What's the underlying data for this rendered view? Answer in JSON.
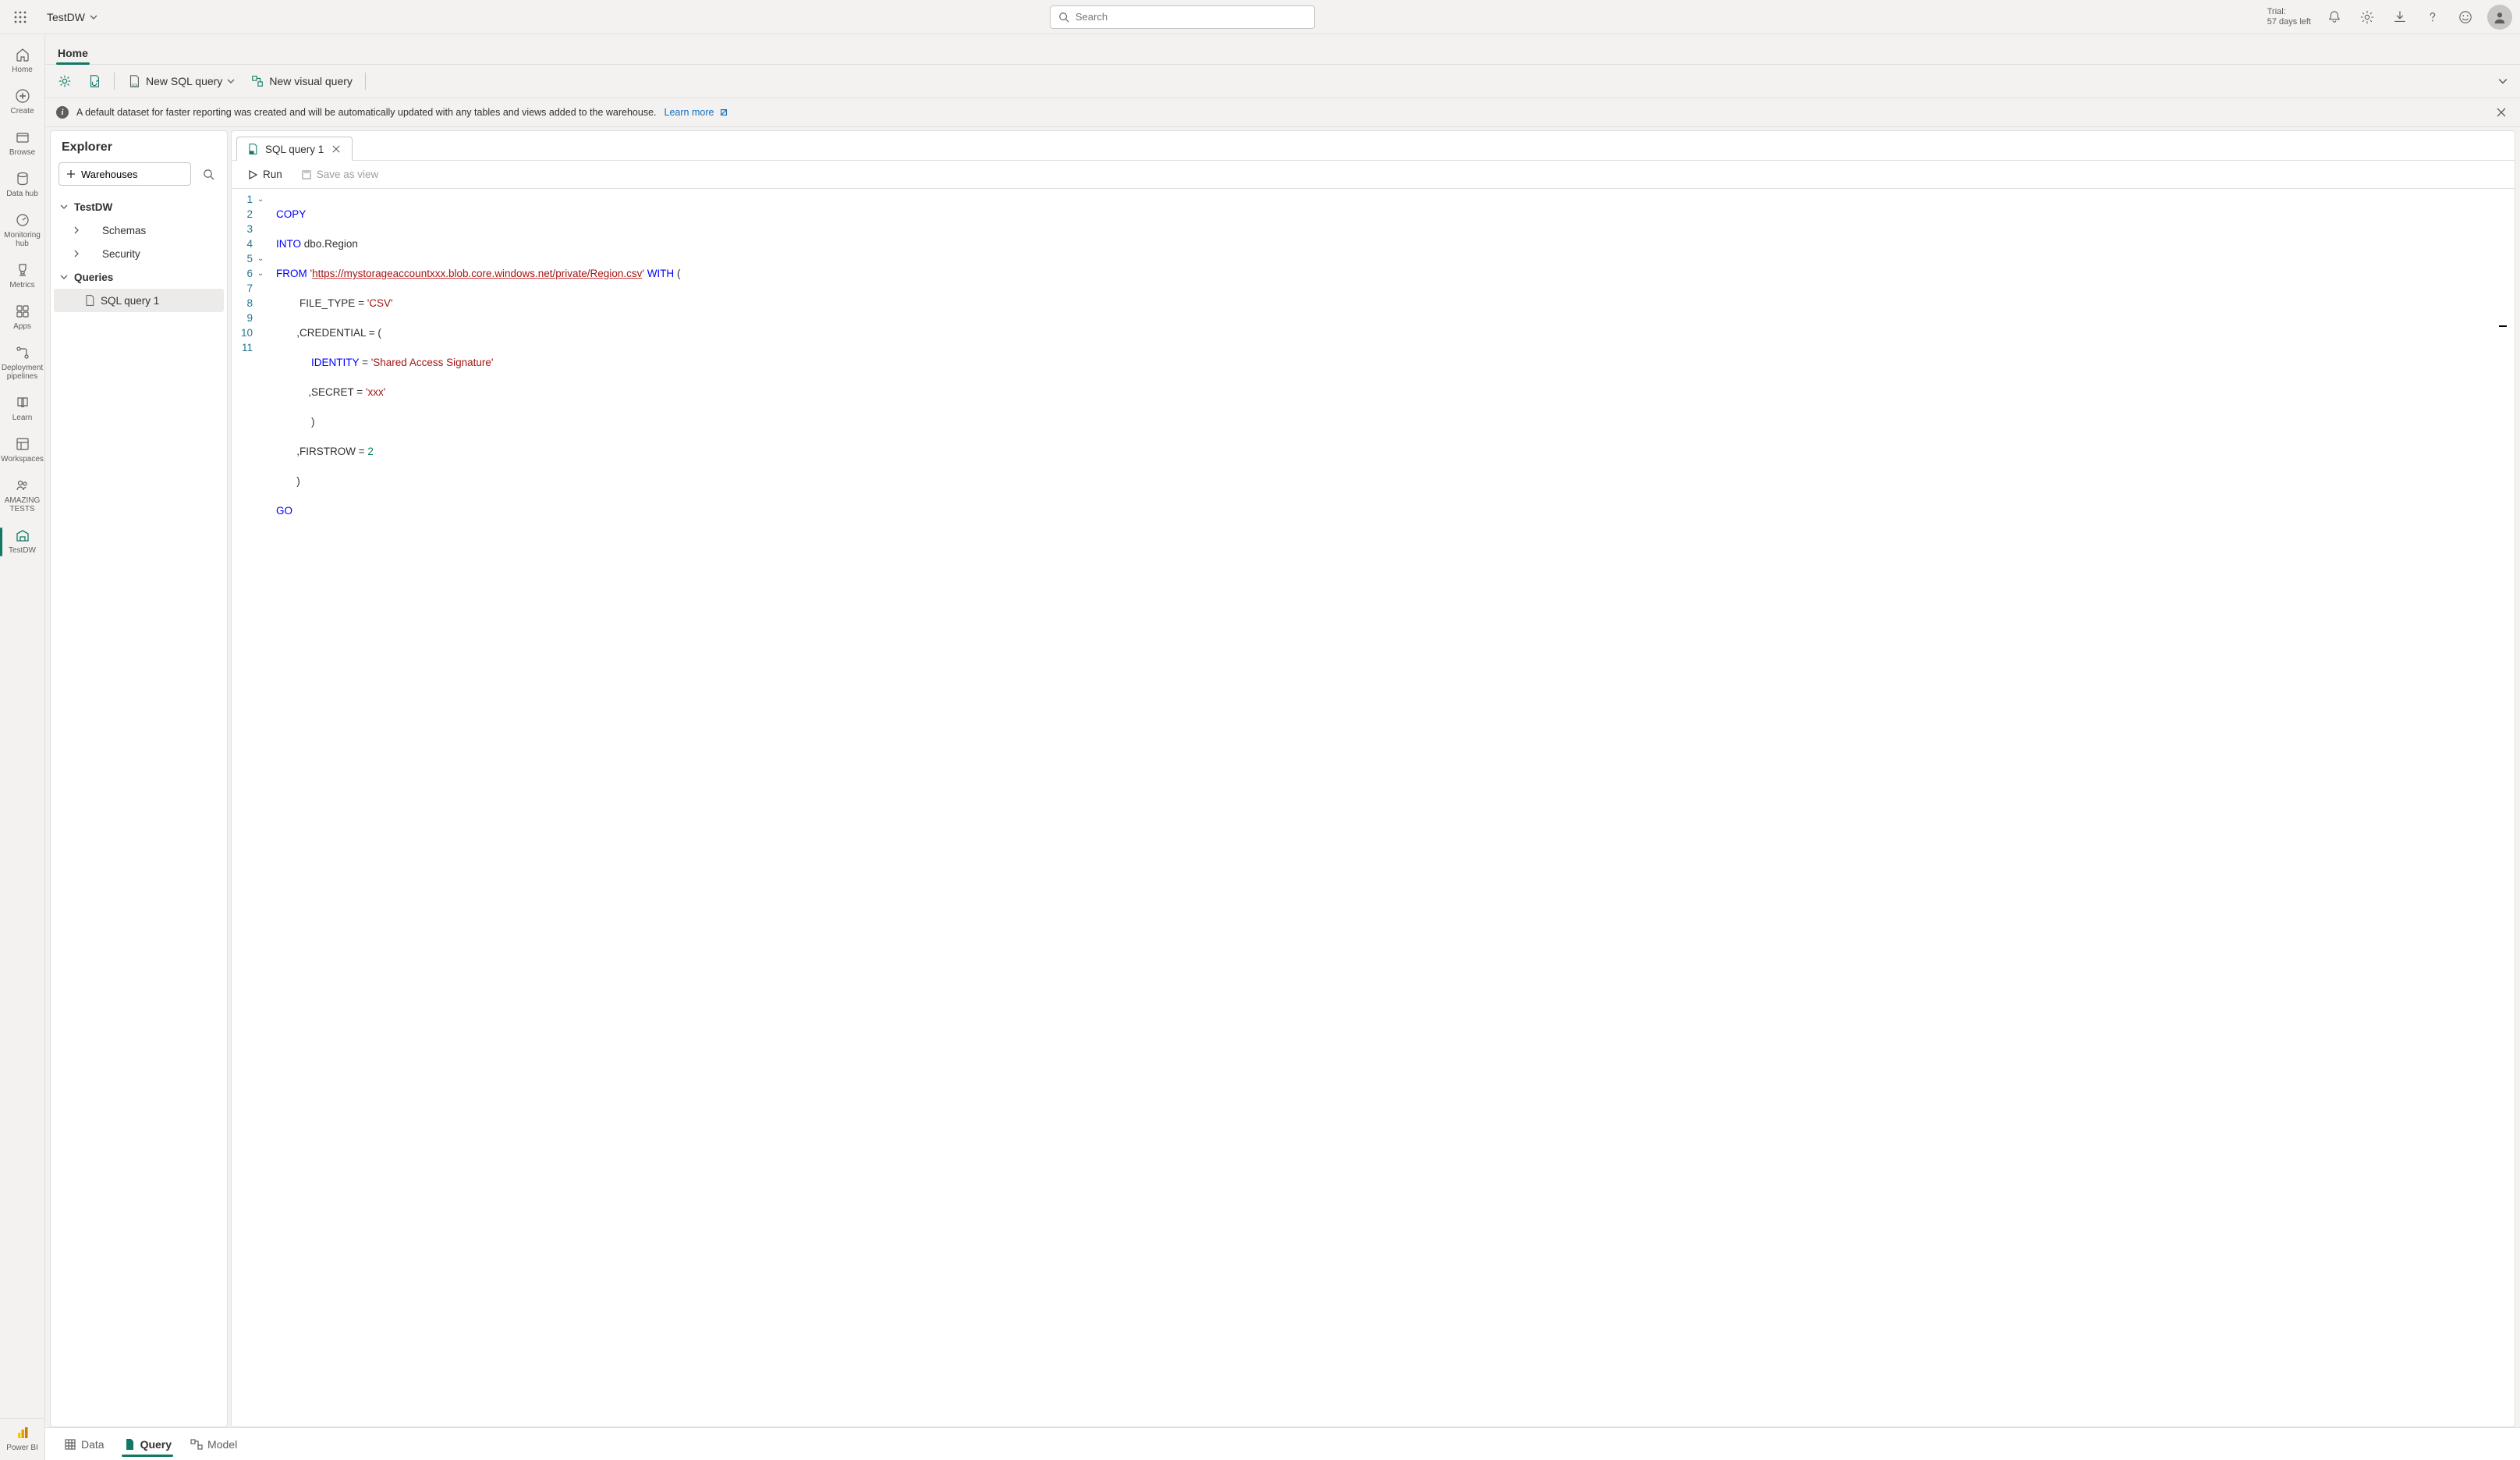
{
  "header": {
    "workspaceName": "TestDW",
    "searchPlaceholder": "Search",
    "trialLine1": "Trial:",
    "trialLine2": "57 days left"
  },
  "leftRail": {
    "home": "Home",
    "create": "Create",
    "browse": "Browse",
    "datahub": "Data hub",
    "monitoring": "Monitoring hub",
    "metrics": "Metrics",
    "apps": "Apps",
    "deployment": "Deployment pipelines",
    "learn": "Learn",
    "workspaces": "Workspaces",
    "amazing": "AMAZING TESTS",
    "testdw": "TestDW",
    "powerbi": "Power BI"
  },
  "ribbon": {
    "homeTab": "Home",
    "newSql": "New SQL query",
    "newVisual": "New visual query"
  },
  "banner": {
    "text": "A default dataset for faster reporting was created and will be automatically updated with any tables and views added to the warehouse.",
    "learnMore": "Learn more"
  },
  "explorer": {
    "title": "Explorer",
    "addWarehouses": "Warehouses",
    "root": "TestDW",
    "schemas": "Schemas",
    "security": "Security",
    "queries": "Queries",
    "query1": "SQL query 1"
  },
  "editor": {
    "tab1": "SQL query 1",
    "run": "Run",
    "saveAsView": "Save as view",
    "code": {
      "l1_copy": "COPY",
      "l2_into": "INTO",
      "l2_rest": " dbo.Region",
      "l3_from": "FROM",
      "l3_url": "https://mystorageaccountxxx.blob.core.windows.net/private/Region.csv",
      "l3_with": "WITH",
      "l4_pre": "        FILE_TYPE = ",
      "l4_str": "'CSV'",
      "l5": "       ,CREDENTIAL = (",
      "l6_pre": "            ",
      "l6_kw": "IDENTITY",
      "l6_mid": " = ",
      "l6_str": "'Shared Access Signature'",
      "l7_pre": "           ,SECRET = ",
      "l7_str": "'xxx'",
      "l8": "            )",
      "l9_pre": "       ,FIRSTROW = ",
      "l9_num": "2",
      "l10": "       )",
      "l11": "GO"
    }
  },
  "bottomTabs": {
    "data": "Data",
    "query": "Query",
    "model": "Model"
  }
}
